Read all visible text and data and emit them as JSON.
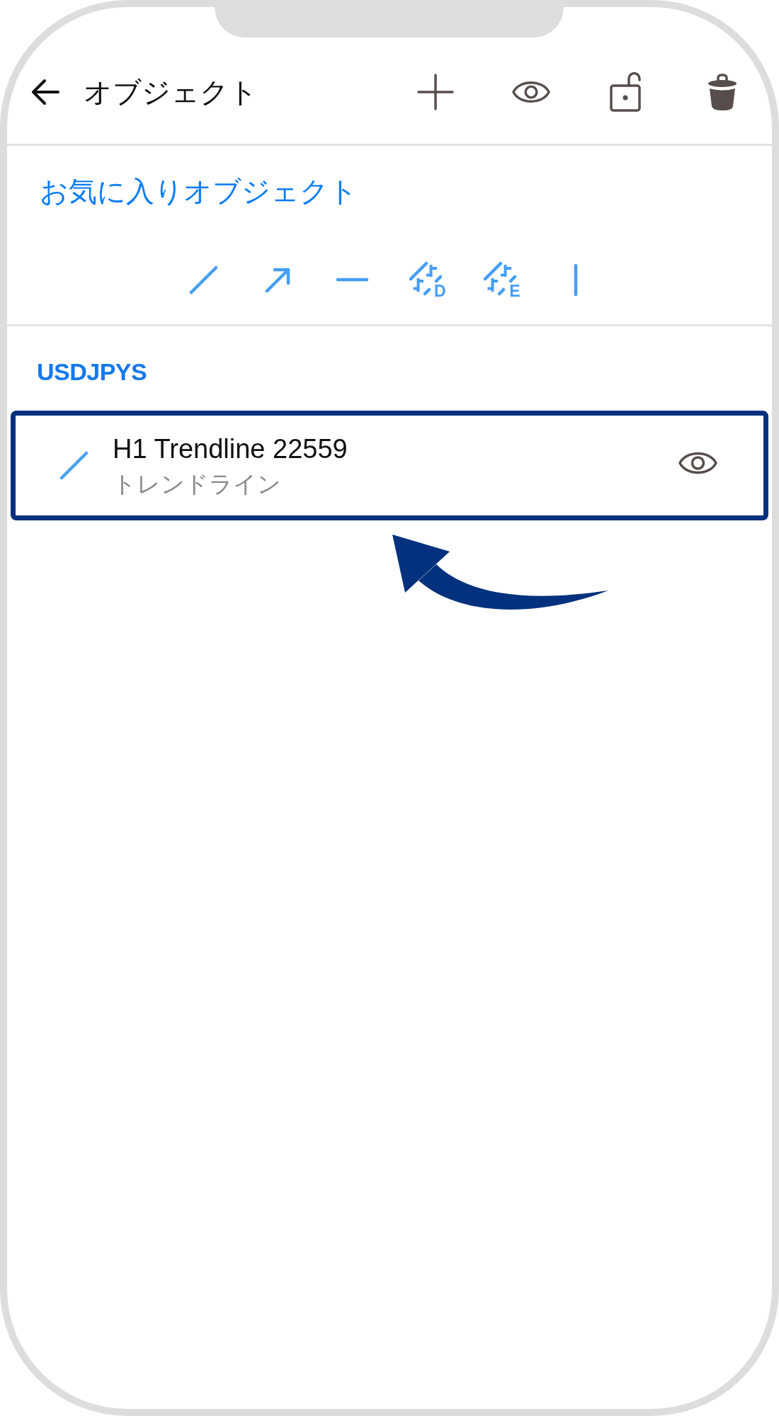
{
  "header": {
    "title": "オブジェクト",
    "actions": [
      {
        "kind": "add"
      },
      {
        "kind": "show"
      },
      {
        "kind": "lock",
        "locked": false
      },
      {
        "kind": "delete"
      }
    ]
  },
  "favorites": {
    "title": "お気に入りオブジェクト",
    "tools": [
      {
        "kind": "trendline"
      },
      {
        "kind": "arrowed-line"
      },
      {
        "kind": "horizontal-line"
      },
      {
        "kind": "lettered",
        "letter": "D"
      },
      {
        "kind": "lettered",
        "letter": "E"
      },
      {
        "kind": "vertical-line"
      }
    ]
  },
  "groups": [
    {
      "symbol": "USDJPYS",
      "objects": [
        {
          "kind": "trendline",
          "name": "H1 Trendline 22559",
          "type": "トレンドライン",
          "visible": true,
          "highlighted": true
        }
      ]
    }
  ]
}
